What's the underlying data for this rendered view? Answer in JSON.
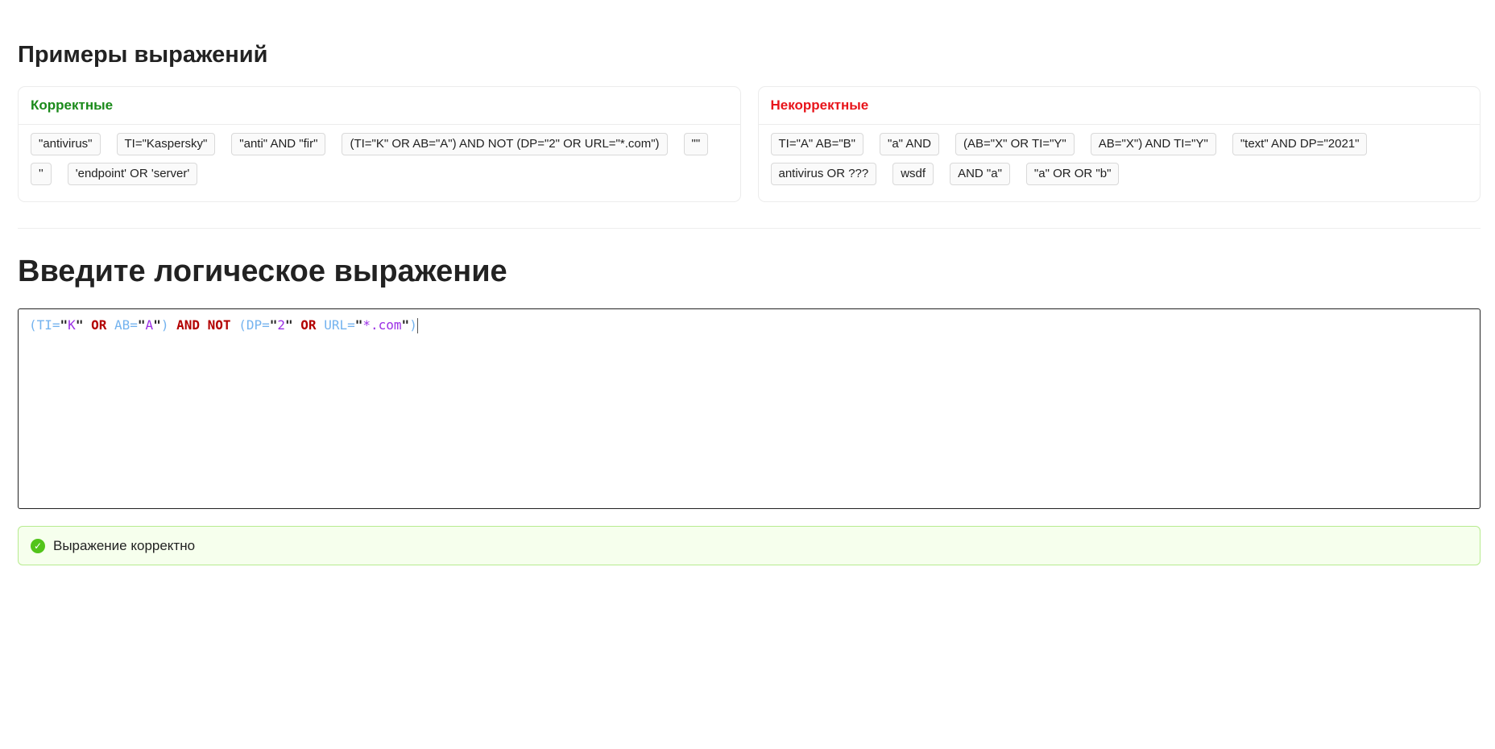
{
  "examples_title": "Примеры выражений",
  "correct": {
    "title": "Корректные",
    "color": "#1a8a1a",
    "items": [
      "\"antivirus\"",
      "TI=\"Kaspersky\"",
      "\"anti\" AND \"fir\"",
      "(TI=\"K\" OR AB=\"A\") AND NOT (DP=\"2\" OR URL=\"*.com\")",
      "\"\"",
      "''",
      "'endpoint' OR 'server'"
    ]
  },
  "incorrect": {
    "title": "Некорректные",
    "color": "#e8141a",
    "items": [
      "TI=\"A\" AB=\"B\"",
      "\"a\" AND",
      "(AB=\"X\" OR TI=\"Y\"",
      "AB=\"X\") AND TI=\"Y\"",
      "\"text\" AND DP=\"2021\"",
      "antivirus OR ???",
      "wsdf",
      "AND \"a\"",
      "\"a\" OR OR \"b\""
    ]
  },
  "input_title": "Введите логическое выражение",
  "editor": {
    "tokens": [
      [
        "p",
        "(TI="
      ],
      [
        "q",
        "\""
      ],
      [
        "v",
        "K"
      ],
      [
        "q",
        "\""
      ],
      [
        "s",
        " "
      ],
      [
        "k",
        "OR"
      ],
      [
        "s",
        " "
      ],
      [
        "p",
        "AB="
      ],
      [
        "q",
        "\""
      ],
      [
        "v",
        "A"
      ],
      [
        "q",
        "\""
      ],
      [
        "p",
        ")"
      ],
      [
        "s",
        " "
      ],
      [
        "k",
        "AND"
      ],
      [
        "s",
        " "
      ],
      [
        "k",
        "NOT"
      ],
      [
        "s",
        " "
      ],
      [
        "p",
        "(DP="
      ],
      [
        "q",
        "\""
      ],
      [
        "v",
        "2"
      ],
      [
        "q",
        "\""
      ],
      [
        "s",
        " "
      ],
      [
        "k",
        "OR"
      ],
      [
        "s",
        " "
      ],
      [
        "p",
        "URL="
      ],
      [
        "q",
        "\""
      ],
      [
        "v",
        "*.com"
      ],
      [
        "q",
        "\""
      ],
      [
        "p",
        ")"
      ]
    ]
  },
  "status": {
    "text": "Выражение корректно",
    "icon": "check-circle-icon"
  }
}
